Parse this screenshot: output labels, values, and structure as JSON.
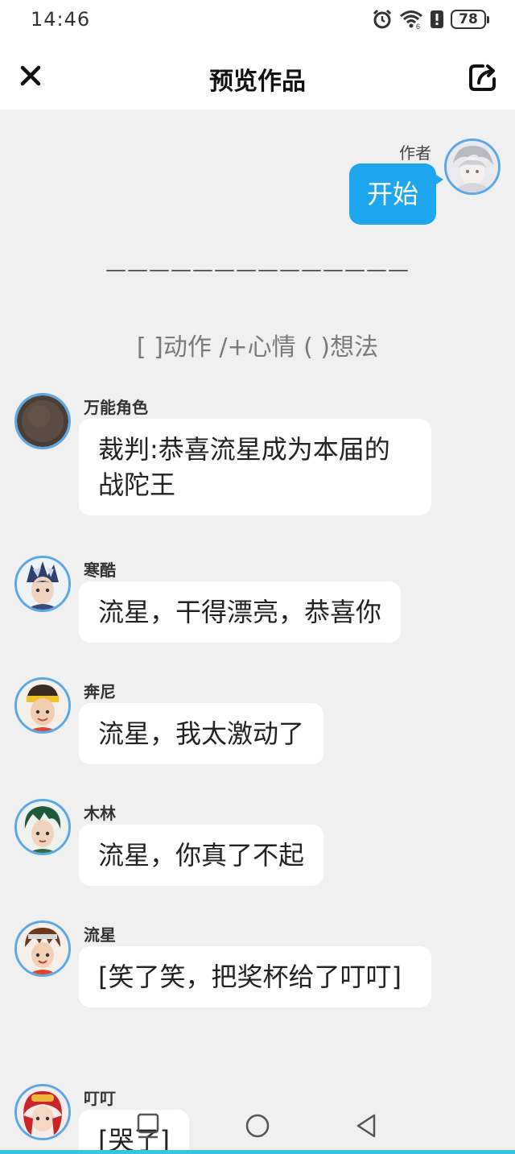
{
  "status": {
    "time": "14:46",
    "battery": "78"
  },
  "header": {
    "title": "预览作品"
  },
  "author": {
    "name": "作者",
    "message": "开始"
  },
  "divider": "——————————————",
  "hint": "[ ]动作   /+心情   ( )想法",
  "messages": [
    {
      "name": "万能角色",
      "text": "裁判:恭喜流星成为本届的战陀王"
    },
    {
      "name": "寒酷",
      "text": "流星，干得漂亮，恭喜你"
    },
    {
      "name": "奔尼",
      "text": "流星，我太激动了"
    },
    {
      "name": "木林",
      "text": "流星，你真了不起"
    },
    {
      "name": "流星",
      "text": "[笑了笑，把奖杯给了叮叮]"
    },
    {
      "name": "叮叮",
      "text": "[哭了]"
    }
  ],
  "icons": {
    "close": "close-icon",
    "share": "share-icon",
    "alarm": "alarm-icon",
    "wifi": "wifi-icon",
    "alert": "alert-icon",
    "battery": "battery-icon",
    "nav_recent": "square-icon",
    "nav_home": "circle-icon",
    "nav_back": "triangle-back-icon"
  },
  "colors": {
    "accent": "#1ea6ee",
    "avatar_ring": "#5aa9e6",
    "background": "#f0f0f0",
    "nav_accent": "#36c6e0"
  }
}
